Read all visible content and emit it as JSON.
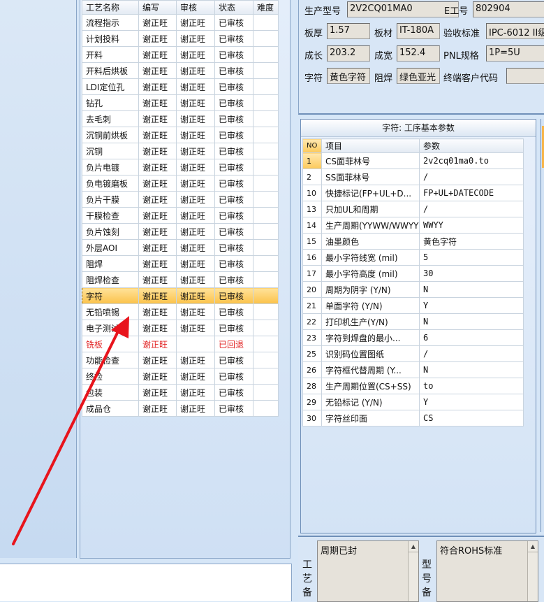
{
  "process_grid": {
    "headers": [
      "工艺名称",
      "编写",
      "审核",
      "状态",
      "难度"
    ],
    "rows": [
      {
        "name": "流程指示",
        "writer": "谢正旺",
        "reviewer": "谢正旺",
        "status": "已审核",
        "difficulty": ""
      },
      {
        "name": "计划投料",
        "writer": "谢正旺",
        "reviewer": "谢正旺",
        "status": "已审核",
        "difficulty": ""
      },
      {
        "name": "开料",
        "writer": "谢正旺",
        "reviewer": "谢正旺",
        "status": "已审核",
        "difficulty": ""
      },
      {
        "name": "开料后烘板",
        "writer": "谢正旺",
        "reviewer": "谢正旺",
        "status": "已审核",
        "difficulty": ""
      },
      {
        "name": "LDI定位孔",
        "writer": "谢正旺",
        "reviewer": "谢正旺",
        "status": "已审核",
        "difficulty": ""
      },
      {
        "name": "钻孔",
        "writer": "谢正旺",
        "reviewer": "谢正旺",
        "status": "已审核",
        "difficulty": ""
      },
      {
        "name": "去毛刺",
        "writer": "谢正旺",
        "reviewer": "谢正旺",
        "status": "已审核",
        "difficulty": ""
      },
      {
        "name": "沉铜前烘板",
        "writer": "谢正旺",
        "reviewer": "谢正旺",
        "status": "已审核",
        "difficulty": ""
      },
      {
        "name": "沉铜",
        "writer": "谢正旺",
        "reviewer": "谢正旺",
        "status": "已审核",
        "difficulty": ""
      },
      {
        "name": "负片电镀",
        "writer": "谢正旺",
        "reviewer": "谢正旺",
        "status": "已审核",
        "difficulty": ""
      },
      {
        "name": "负电镀磨板",
        "writer": "谢正旺",
        "reviewer": "谢正旺",
        "status": "已审核",
        "difficulty": ""
      },
      {
        "name": "负片干膜",
        "writer": "谢正旺",
        "reviewer": "谢正旺",
        "status": "已审核",
        "difficulty": ""
      },
      {
        "name": "干膜检查",
        "writer": "谢正旺",
        "reviewer": "谢正旺",
        "status": "已审核",
        "difficulty": ""
      },
      {
        "name": "负片蚀刻",
        "writer": "谢正旺",
        "reviewer": "谢正旺",
        "status": "已审核",
        "difficulty": ""
      },
      {
        "name": "外层AOI",
        "writer": "谢正旺",
        "reviewer": "谢正旺",
        "status": "已审核",
        "difficulty": ""
      },
      {
        "name": "阻焊",
        "writer": "谢正旺",
        "reviewer": "谢正旺",
        "status": "已审核",
        "difficulty": ""
      },
      {
        "name": "阻焊检查",
        "writer": "谢正旺",
        "reviewer": "谢正旺",
        "status": "已审核",
        "difficulty": ""
      },
      {
        "name": "字符",
        "writer": "谢正旺",
        "reviewer": "谢正旺",
        "status": "已审核",
        "difficulty": "",
        "selected": true
      },
      {
        "name": "无铅喷锡",
        "writer": "谢正旺",
        "reviewer": "谢正旺",
        "status": "已审核",
        "difficulty": ""
      },
      {
        "name": "电子测试",
        "writer": "谢正旺",
        "reviewer": "谢正旺",
        "status": "已审核",
        "difficulty": ""
      },
      {
        "name": "铣板",
        "writer": "谢正旺",
        "reviewer": "",
        "status": "已回退",
        "difficulty": "",
        "rejected": true
      },
      {
        "name": "功能检查",
        "writer": "谢正旺",
        "reviewer": "谢正旺",
        "status": "已审核",
        "difficulty": ""
      },
      {
        "name": "终检",
        "writer": "谢正旺",
        "reviewer": "谢正旺",
        "status": "已审核",
        "difficulty": ""
      },
      {
        "name": "包装",
        "writer": "谢正旺",
        "reviewer": "谢正旺",
        "status": "已审核",
        "difficulty": ""
      },
      {
        "name": "成品仓",
        "writer": "谢正旺",
        "reviewer": "谢正旺",
        "status": "已审核",
        "difficulty": ""
      }
    ]
  },
  "info": {
    "model_label": "生产型号",
    "model_value": "2V2CQ01MA0",
    "e_no_label": "E工号",
    "e_no_value": "802904",
    "thickness_label": "板厚",
    "thickness_value": "1.57",
    "material_label": "板材",
    "material_value": "IT-180A",
    "standard_label": "验收标准",
    "standard_value": "IPC-6012 II级",
    "length_label": "成长",
    "length_value": "203.2",
    "width_label": "成宽",
    "width_value": "152.4",
    "pnl_label": "PNL规格",
    "pnl_value": "1P=5U",
    "silk_label": "字符",
    "silk_value": "黄色字符",
    "mask_label": "阻焊",
    "mask_value": "绿色亚光",
    "customer_label": "终端客户代码",
    "customer_value": ""
  },
  "params": {
    "title": "字符: 工序基本参数",
    "headers": [
      "NO",
      "项目",
      "参数"
    ],
    "rows": [
      {
        "no": "1",
        "item": "CS面菲林号",
        "value": "2v2cq01ma0.to"
      },
      {
        "no": "2",
        "item": "SS面菲林号",
        "value": "/"
      },
      {
        "no": "10",
        "item": "快捷标记(FP+UL+D...",
        "value": "FP+UL+DATECODE"
      },
      {
        "no": "13",
        "item": "只加UL和周期",
        "value": "/"
      },
      {
        "no": "14",
        "item": "生产周期(YYWW/WWYY)",
        "value": "WWYY"
      },
      {
        "no": "15",
        "item": "油墨颜色",
        "value": "黄色字符"
      },
      {
        "no": "16",
        "item": "最小字符线宽 (mil)",
        "value": "5"
      },
      {
        "no": "17",
        "item": "最小字符高度 (mil)",
        "value": "30"
      },
      {
        "no": "20",
        "item": "周期为阴字 (Y/N)",
        "value": "N"
      },
      {
        "no": "21",
        "item": "单面字符 (Y/N)",
        "value": "Y"
      },
      {
        "no": "22",
        "item": "打印机生产(Y/N)",
        "value": "N"
      },
      {
        "no": "23",
        "item": "字符到焊盘的最小...",
        "value": "6"
      },
      {
        "no": "25",
        "item": "识别码位置图纸",
        "value": "/"
      },
      {
        "no": "26",
        "item": "字符框代替周期 (Y...",
        "value": "N"
      },
      {
        "no": "28",
        "item": "生产周期位置(CS+SS)",
        "value": "to"
      },
      {
        "no": "29",
        "item": "无铅标记 (Y/N)",
        "value": "Y"
      },
      {
        "no": "30",
        "item": "字符丝印面",
        "value": "CS"
      }
    ]
  },
  "memo": {
    "process_note_label": "工艺备",
    "process_note_value": "周期已封",
    "model_note_label": "型号备",
    "model_note_value": "符合ROHS标准"
  },
  "colors": {
    "annotation_arrow": "#e8141c",
    "selected_row": "#fcc95a",
    "rejected_text": "#e22424"
  }
}
